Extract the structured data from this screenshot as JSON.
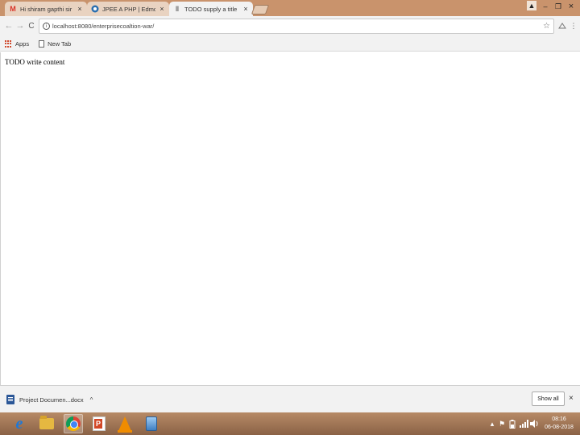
{
  "browser": {
    "tabs": [
      {
        "title": "Hi shiram gapthi sir - I",
        "icon": "gmail-icon",
        "active": false
      },
      {
        "title": "JPEE A PHP | Edmodo",
        "icon": "edmodo-icon",
        "active": false
      },
      {
        "title": "TODO supply a title",
        "icon": "page-icon",
        "active": true
      }
    ],
    "window_controls": {
      "profile": "▲",
      "minimize": "–",
      "maximize": "❐",
      "close": "×"
    },
    "toolbar": {
      "back": "←",
      "forward": "→",
      "reload": "C",
      "url": "localhost:8080/enterprisecoaltion-war/",
      "info": "i",
      "star": "☆"
    },
    "bookmarks": [
      {
        "label": "Apps",
        "icon": "apps-grid-icon"
      },
      {
        "label": "New Tab",
        "icon": "document-icon"
      }
    ]
  },
  "page": {
    "content_text": "TODO write content"
  },
  "download_shelf": {
    "file_name": "Project Documen...docx",
    "caret": "^",
    "show_all": "Show all",
    "close": "×"
  },
  "taskbar": {
    "apps": [
      "internet-explorer-icon",
      "file-explorer-icon",
      "chrome-icon",
      "powerpoint-icon",
      "vlc-icon",
      "virtualbox-icon"
    ],
    "tray_caret": "▴",
    "flag": "⚑",
    "clock_time": "08:16",
    "clock_date": "06-08-2018"
  },
  "colors": {
    "tabstrip": "#c9936c",
    "toolbar": "#f2f2f2",
    "taskbar": "#8a6246"
  }
}
